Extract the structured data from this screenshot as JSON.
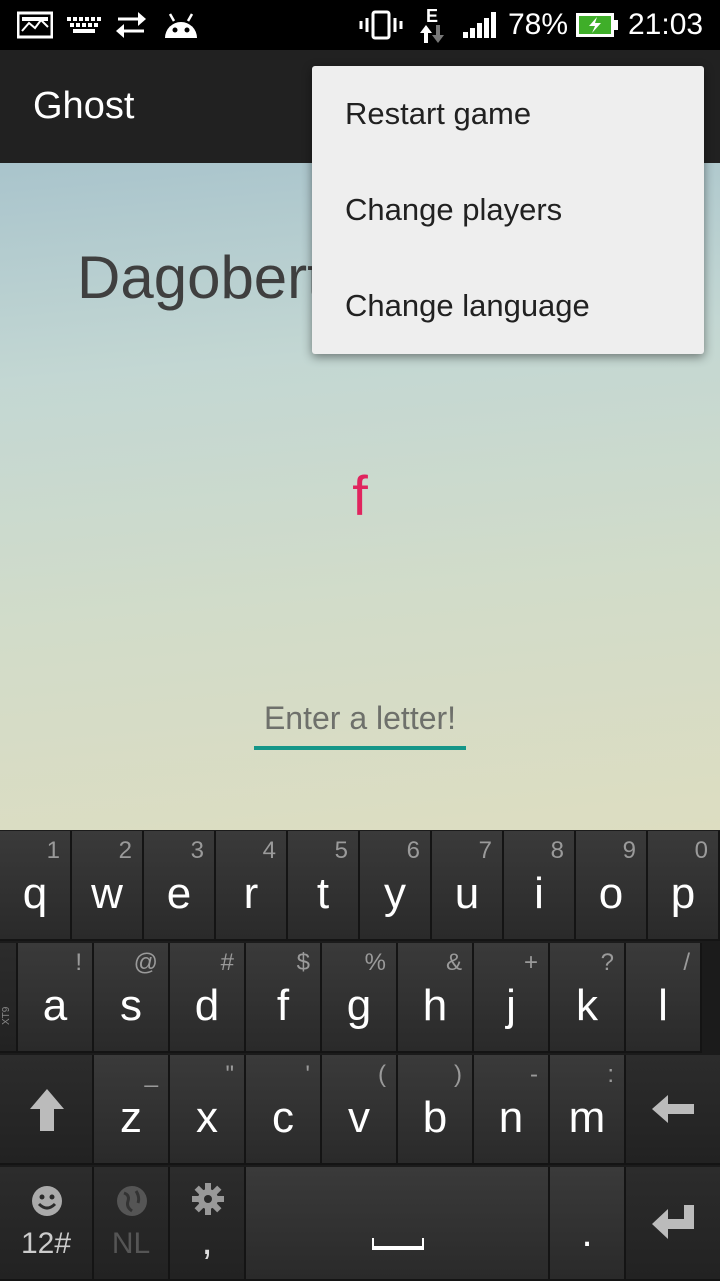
{
  "status_bar": {
    "icons": [
      "screenshot-icon",
      "keyboard-icon",
      "sync-icon",
      "android-icon",
      "vibrate-icon",
      "network-e-icon",
      "signal-icon",
      "battery-icon"
    ],
    "network_type": "E",
    "battery": "78%",
    "time": "21:03"
  },
  "action_bar": {
    "title": "Ghost"
  },
  "game": {
    "player_name": "Dagobert",
    "current_word": "f",
    "input_placeholder": "Enter a letter!",
    "input_value": ""
  },
  "menu": {
    "items": [
      "Restart game",
      "Change players",
      "Change language"
    ]
  },
  "keyboard": {
    "row1": [
      {
        "main": "q",
        "alt": "1"
      },
      {
        "main": "w",
        "alt": "2"
      },
      {
        "main": "e",
        "alt": "3"
      },
      {
        "main": "r",
        "alt": "4"
      },
      {
        "main": "t",
        "alt": "5"
      },
      {
        "main": "y",
        "alt": "6"
      },
      {
        "main": "u",
        "alt": "7"
      },
      {
        "main": "i",
        "alt": "8"
      },
      {
        "main": "o",
        "alt": "9"
      },
      {
        "main": "p",
        "alt": "0"
      }
    ],
    "row2": [
      {
        "main": "a",
        "alt": "!"
      },
      {
        "main": "s",
        "alt": "@"
      },
      {
        "main": "d",
        "alt": "#"
      },
      {
        "main": "f",
        "alt": "$"
      },
      {
        "main": "g",
        "alt": "%"
      },
      {
        "main": "h",
        "alt": "&"
      },
      {
        "main": "j",
        "alt": "+"
      },
      {
        "main": "k",
        "alt": "?"
      },
      {
        "main": "l",
        "alt": "/"
      }
    ],
    "row3": [
      {
        "main": "z",
        "alt": "_"
      },
      {
        "main": "x",
        "alt": "\""
      },
      {
        "main": "c",
        "alt": "'"
      },
      {
        "main": "v",
        "alt": "("
      },
      {
        "main": "b",
        "alt": ")"
      },
      {
        "main": "n",
        "alt": "-"
      },
      {
        "main": "m",
        "alt": ":"
      }
    ],
    "side_label": "XT9",
    "symbols_label": "12#",
    "language_label": "NL",
    "comma_label": ",",
    "period_label": "."
  }
}
